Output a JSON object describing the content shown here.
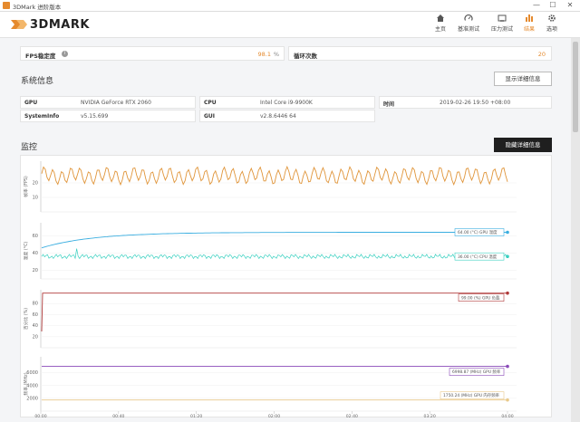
{
  "window": {
    "title": "3DMark 进阶版本",
    "minimize": "—",
    "maximize": "☐",
    "close": "✕"
  },
  "brand": {
    "logo_text": "3DMARK"
  },
  "nav": [
    {
      "label": "主页",
      "icon": "home-icon"
    },
    {
      "label": "基准测试",
      "icon": "gauge-icon"
    },
    {
      "label": "压力测试",
      "icon": "stress-icon"
    },
    {
      "label": "结果",
      "icon": "bar-chart-icon",
      "active": true
    },
    {
      "label": "选项",
      "icon": "gear-icon"
    }
  ],
  "summary": {
    "fps_label": "FPS稳定度",
    "fps_value": "98.1",
    "fps_unit": "%",
    "loop_label": "循环次数",
    "loop_value": "20"
  },
  "system": {
    "title": "系统信息",
    "details_button": "显示详细信息",
    "rows": [
      {
        "k": "GPU",
        "v": "NVIDIA GeForce RTX 2060"
      },
      {
        "k": "SystemInfo",
        "v": "v5.15.699"
      },
      {
        "k": "CPU",
        "v": "Intel Core i9-9900K"
      },
      {
        "k": "GUI",
        "v": "v2.8.6446 64"
      },
      {
        "k": "时间",
        "v": "2019-02-26 19:50 +08:00"
      }
    ]
  },
  "monitor": {
    "title": "监控",
    "hide_button": "隐藏详细信息"
  },
  "colors": {
    "accent": "#e58a2e",
    "fps": "#e0953a",
    "gpu_temp": "#3aaee0",
    "cpu_temp": "#3bd0c0",
    "gpu_load": "#b03a3a",
    "gpu_clock": "#8a4ab8",
    "gpu_mem": "#e9c98a"
  },
  "chart_data": {
    "type": "line",
    "panels": [
      {
        "ylabel": "帧率 (FPS)",
        "ticks": [
          "20",
          "10"
        ],
        "series": [
          {
            "name": "FPS",
            "color": "#e0953a"
          }
        ]
      },
      {
        "ylabel": "温度 (°C)",
        "ticks": [
          "60",
          "40",
          "20"
        ],
        "series": [
          {
            "name": "GPU 温度",
            "value": 64.0,
            "label": "64.00 (°C) GPU 温度",
            "color": "#3aaee0"
          },
          {
            "name": "CPU 温度",
            "value": 36.0,
            "label": "36.00 (°C) CPU 温度",
            "color": "#3bd0c0"
          }
        ]
      },
      {
        "ylabel": "百分比 (%)",
        "ticks": [
          "80",
          "60",
          "40",
          "20"
        ],
        "series": [
          {
            "name": "GPU 负载",
            "value": 99.0,
            "label": "99.00 (%) GPU 负载",
            "color": "#b03a3a"
          }
        ]
      },
      {
        "ylabel": "频率 (MHz)",
        "ticks": [
          "6000",
          "4000",
          "2000"
        ],
        "series": [
          {
            "name": "GPU 频率",
            "value": 6998.87,
            "label": "6998.87 (MHz) GPU 频率",
            "color": "#8a4ab8"
          },
          {
            "name": "GPU 内存频率",
            "value": 1750.24,
            "label": "1750.24 (MHz) GPU 内存频率",
            "color": "#e9c98a"
          }
        ]
      }
    ],
    "x_ticks": [
      "00:00",
      "00:40",
      "01:20",
      "02:00",
      "02:40",
      "03:20",
      "04:00"
    ]
  }
}
